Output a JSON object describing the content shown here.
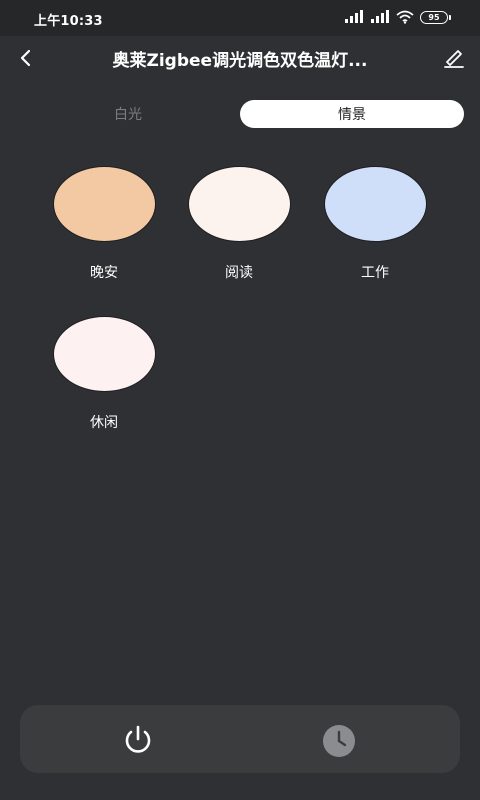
{
  "status_bar": {
    "time": "上午10:33",
    "battery_level": "95"
  },
  "header": {
    "title": "奥莱Zigbee调光调色双色温灯...",
    "back_icon": "chevron-left-icon",
    "edit_icon": "pencil-icon"
  },
  "tabs": {
    "white_light": "白光",
    "scene": "情景",
    "selected": "scene"
  },
  "scenes": [
    {
      "label": "晚安",
      "color": "#f3c9a3"
    },
    {
      "label": "阅读",
      "color": "#fcf3ee"
    },
    {
      "label": "工作",
      "color": "#cfdffa"
    },
    {
      "label": "休闲",
      "color": "#fdf1f1"
    }
  ],
  "bottom_bar": {
    "power_icon": "power-icon",
    "timer_icon": "clock-icon"
  }
}
